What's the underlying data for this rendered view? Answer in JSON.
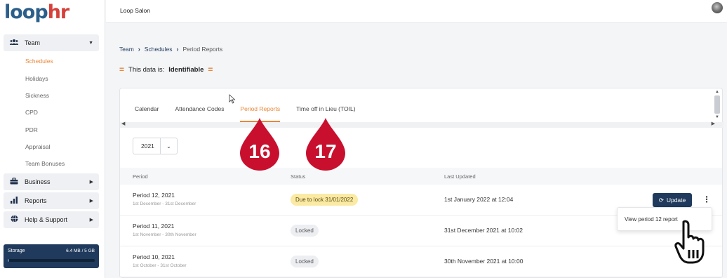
{
  "brand": {
    "logo_loop": "loop",
    "logo_hr": "hr"
  },
  "topbar": {
    "org_name": "Loop Salon"
  },
  "sidebar": {
    "groups": [
      {
        "label": "Team",
        "icon": "users-icon"
      },
      {
        "label": "Business",
        "icon": "briefcase-icon"
      },
      {
        "label": "Reports",
        "icon": "bar-chart-icon"
      },
      {
        "label": "Help & Support",
        "icon": "globe-icon"
      }
    ],
    "team_items": [
      "Schedules",
      "Holidays",
      "Sickness",
      "CPD",
      "PDR",
      "Appraisal",
      "Team Bonuses"
    ],
    "active_item": "Schedules",
    "storage": {
      "label": "Storage",
      "value": "6.4 MB / 5 GB",
      "used_fraction": 0.001
    }
  },
  "breadcrumb": {
    "items": [
      "Team",
      "Schedules",
      "Period Reports"
    ]
  },
  "identifiable": {
    "prefix": "This data is:",
    "value": "Identifiable"
  },
  "tabs": [
    {
      "label": "Calendar"
    },
    {
      "label": "Attendance Codes"
    },
    {
      "label": "Period Reports"
    },
    {
      "label": "Time off in Lieu (TOIL)"
    }
  ],
  "active_tab": "Period Reports",
  "year_select": {
    "value": "2021"
  },
  "table": {
    "headers": {
      "period": "Period",
      "status": "Status",
      "updated": "Last Updated"
    },
    "rows": [
      {
        "period": "Period 12, 2021",
        "range": "1st December - 31st December",
        "status": "Due to lock 31/01/2022",
        "status_type": "due",
        "updated": "1st January 2022 at 12:04"
      },
      {
        "period": "Period 11, 2021",
        "range": "1st November - 30th November",
        "status": "Locked",
        "status_type": "locked",
        "updated": "31st December 2021 at 10:02"
      },
      {
        "period": "Period 10, 2021",
        "range": "1st October - 31st October",
        "status": "Locked",
        "status_type": "locked",
        "updated": "30th November 2021 at 10:00"
      }
    ]
  },
  "update_button": {
    "label": "Update"
  },
  "row_menu": {
    "item": "View period 12 report"
  },
  "markers": [
    {
      "label": "16"
    },
    {
      "label": "17"
    }
  ],
  "colors": {
    "accent": "#e8873a",
    "navy": "#1f3a5c",
    "marker": "#c8102e"
  }
}
